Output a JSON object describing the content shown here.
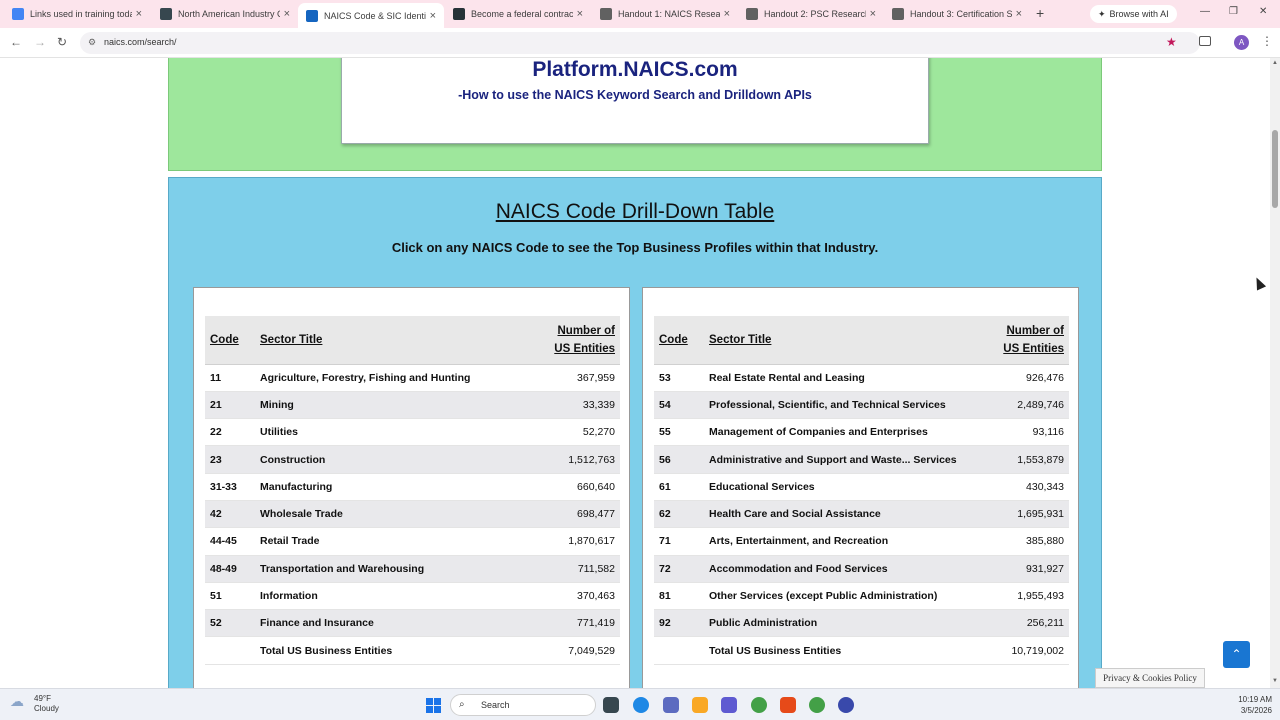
{
  "tabs": [
    {
      "title": "Links used in training today",
      "active": false,
      "icon_color": "#4285f4"
    },
    {
      "title": "North American Industry Cl...",
      "active": false,
      "icon_color": "#37474f"
    },
    {
      "title": "NAICS Code & SIC Identific...",
      "active": true,
      "icon_color": "#1565c0"
    },
    {
      "title": "Become a federal contracto...",
      "active": false,
      "icon_color": "#263238"
    },
    {
      "title": "Handout 1: NAICS Research ...",
      "active": false,
      "icon_color": "#616161"
    },
    {
      "title": "Handout 2: PSC Research W...",
      "active": false,
      "icon_color": "#616161"
    },
    {
      "title": "Handout 3: Certification Str...",
      "active": false,
      "icon_color": "#616161"
    }
  ],
  "browser": {
    "browse_ai": "Browse with AI",
    "url": "naics.com/search/"
  },
  "page": {
    "platform_title": "Platform.NAICS.com",
    "platform_subtitle": "-How to use the NAICS Keyword Search and Drilldown APIs",
    "drill_title": "NAICS Code Drill-Down Table",
    "drill_subtitle": "Click on any NAICS Code to see the Top Business Profiles within that Industry.",
    "columns": {
      "code": "Code",
      "sector": "Sector Title",
      "num_line1": "Number of",
      "num_line2": "US Entities"
    },
    "left_rows": [
      {
        "code": "11",
        "title": "Agriculture, Forestry, Fishing and Hunting",
        "count": "367,959"
      },
      {
        "code": "21",
        "title": "Mining",
        "count": "33,339"
      },
      {
        "code": "22",
        "title": "Utilities",
        "count": "52,270"
      },
      {
        "code": "23",
        "title": "Construction",
        "count": "1,512,763"
      },
      {
        "code": "31-33",
        "title": "Manufacturing",
        "count": "660,640"
      },
      {
        "code": "42",
        "title": "Wholesale Trade",
        "count": "698,477"
      },
      {
        "code": "44-45",
        "title": "Retail Trade",
        "count": "1,870,617"
      },
      {
        "code": "48-49",
        "title": "Transportation and Warehousing",
        "count": "711,582"
      },
      {
        "code": "51",
        "title": "Information",
        "count": "370,463"
      },
      {
        "code": "52",
        "title": "Finance and Insurance",
        "count": "771,419"
      }
    ],
    "left_total": {
      "label": "Total US Business Entities",
      "count": "7,049,529"
    },
    "right_rows": [
      {
        "code": "53",
        "title": "Real Estate Rental and Leasing",
        "count": "926,476"
      },
      {
        "code": "54",
        "title": "Professional, Scientific, and Technical Services",
        "count": "2,489,746"
      },
      {
        "code": "55",
        "title": "Management of Companies and Enterprises",
        "count": "93,116"
      },
      {
        "code": "56",
        "title": "Administrative and Support and Waste... Services",
        "count": "1,553,879"
      },
      {
        "code": "61",
        "title": "Educational Services",
        "count": "430,343"
      },
      {
        "code": "62",
        "title": "Health Care and Social Assistance",
        "count": "1,695,931"
      },
      {
        "code": "71",
        "title": "Arts, Entertainment, and Recreation",
        "count": "385,880"
      },
      {
        "code": "72",
        "title": "Accommodation and Food Services",
        "count": "931,927"
      },
      {
        "code": "81",
        "title": "Other Services (except Public Administration)",
        "count": "1,955,493"
      },
      {
        "code": "92",
        "title": "Public Administration",
        "count": "256,211"
      }
    ],
    "right_total": {
      "label": "Total US Business Entities",
      "count": "10,719,002"
    },
    "privacy": "Privacy & Cookies Policy"
  },
  "taskbar": {
    "temp": "49°F",
    "weather": "Cloudy",
    "search": "Search",
    "time": "10:19 AM",
    "date": "3/5/2026"
  }
}
